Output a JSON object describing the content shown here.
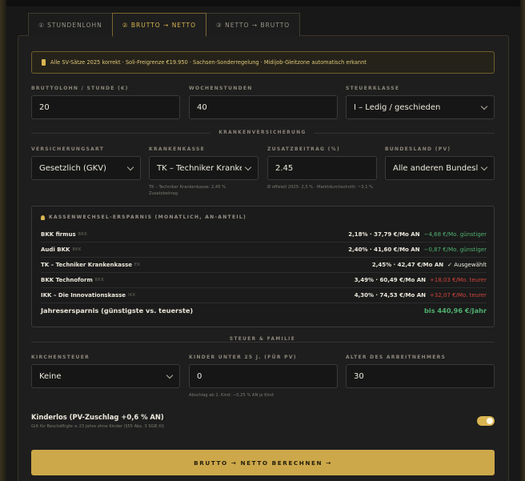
{
  "tabs": [
    {
      "label": "① STUNDENLOHN",
      "active": false
    },
    {
      "label": "② BRUTTO → NETTO",
      "active": true
    },
    {
      "label": "③ NETTO → BRUTTO",
      "active": false
    }
  ],
  "notice": "Alle SV-Sätze 2025 korrekt · Soli-Freigrenze €19.950 · Sachsen-Sonderregelung · Midijob-Gleitzone automatisch erkannt",
  "fields": {
    "bruttolohn": {
      "label": "BRUTTOLOHN / STUNDE (€)",
      "value": "20"
    },
    "wochenstunden": {
      "label": "WOCHENSTUNDEN",
      "value": "40"
    },
    "steuerklasse": {
      "label": "STEUERKLASSE",
      "value": "I – Ledig / geschieden"
    }
  },
  "section_kv": "KRANKENVERSICHERUNG",
  "kv": {
    "versicherungsart": {
      "label": "VERSICHERUNGSART",
      "value": "Gesetzlich (GKV)"
    },
    "krankenkasse": {
      "label": "KRANKENKASSE",
      "value": "TK – Techniker Krankenkasse",
      "hint1": "TK – Techniker Krankenkasse: 2,45 %",
      "hint2": "Zusatzbeitrag"
    },
    "zusatzbeitrag": {
      "label": "ZUSATZBEITRAG (%)",
      "value": "2.45",
      "hint": "Ø offiziell 2025: 2,5 % · Marktdurchschnitt: ~3,1 %"
    },
    "bundesland": {
      "label": "BUNDESLAND (PV)",
      "value": "Alle anderen Bundesländer"
    }
  },
  "savings": {
    "title": "KASSENWECHSEL-ERSPARNIS (MONATLICH, AN-ANTEIL)",
    "rows": [
      {
        "name": "BKK firmus",
        "type": "BKK",
        "vals": "2,18% · 37,79 €/Mo AN",
        "delta": "−4,68 €/Mo. günstiger",
        "tone": "green"
      },
      {
        "name": "Audi BKK",
        "type": "BKK",
        "vals": "2,40% · 41,60 €/Mo AN",
        "delta": "−0,87 €/Mo. günstiger",
        "tone": "green"
      },
      {
        "name": "TK – Techniker Krankenkasse",
        "type": "EK",
        "vals": "2,45% · 42,47 €/Mo AN",
        "delta": "✓ Ausgewählt",
        "tone": "white"
      },
      {
        "name": "BKK Technoform",
        "type": "BKK",
        "vals": "3,49% · 60,49 €/Mo AN",
        "delta": "+18,03 €/Mo. teurer",
        "tone": "red"
      },
      {
        "name": "IKK – Die Innovationskasse",
        "type": "IKK",
        "vals": "4,30% · 74,53 €/Mo AN",
        "delta": "+32,07 €/Mo. teurer",
        "tone": "red"
      }
    ],
    "total_label": "Jahresersparnis (günstigste vs. teuerste)",
    "total_value": "bis 440,96 €/Jahr"
  },
  "section_steuer": "STEUER & FAMILIE",
  "steuer": {
    "kirchensteuer": {
      "label": "KIRCHENSTEUER",
      "value": "Keine"
    },
    "kinder": {
      "label": "KINDER UNTER 25 J. (FÜR PV)",
      "value": "0",
      "hint": "Abschlag ab 2. Kind: −0,25 % AN je Kind"
    },
    "alter": {
      "label": "ALTER DES ARBEITNEHMERS",
      "value": "30"
    }
  },
  "kinderlos": {
    "title": "Kinderlos (PV-Zuschlag +0,6 % AN)",
    "sub": "Gilt für Beschäftigte ≥ 23 Jahre ohne Kinder (§55 Abs. 3 SGB XI)",
    "on": true
  },
  "cta": "BRUTTO → NETTO BERECHNEN →",
  "colors": {
    "accent": "#d9b552",
    "green": "#4fb06f",
    "red": "#d0433c"
  }
}
